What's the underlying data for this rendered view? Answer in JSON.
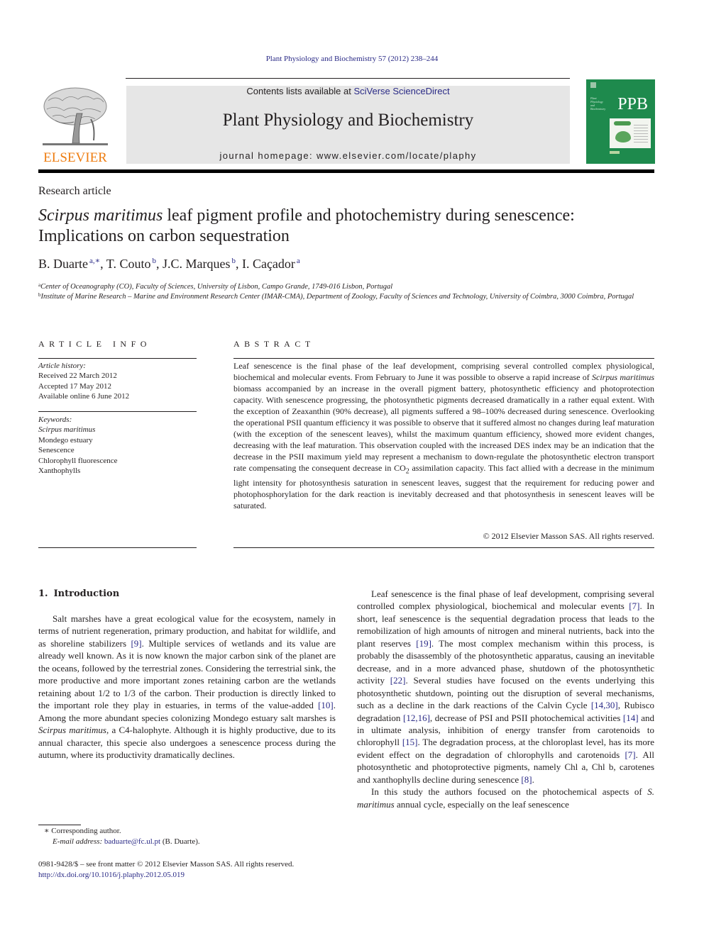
{
  "header": {
    "citation": "Plant Physiology and Biochemistry 57 (2012) 238–244",
    "contents_prefix": "Contents lists available at ",
    "contents_link": "SciVerse ScienceDirect",
    "journal_name": "Plant Physiology and Biochemistry",
    "homepage_prefix": "journal homepage: ",
    "homepage_url": "www.elsevier.com/locate/plaphy",
    "publisher_wordmark": "ELSEVIER",
    "cover_abbrev": "PPB",
    "cover_title_lines": [
      "Plant",
      "Physiology",
      "and",
      "Biochemistry"
    ],
    "colors": {
      "link": "#2a2a86",
      "elsevier_orange": "#ee7d11",
      "cover_green": "#1e8a4d",
      "masthead_gray": "#e6e6e6"
    }
  },
  "article": {
    "type": "Research article",
    "title_italic": "Scirpus maritimus",
    "title_rest_line1": " leaf pigment profile and photochemistry during senescence:",
    "title_line2": "Implications on carbon sequestration",
    "authors": [
      {
        "name": "B. Duarte",
        "sup": "a,∗",
        "sep": ", "
      },
      {
        "name": "T. Couto",
        "sup": "b",
        "sep": ", "
      },
      {
        "name": "J.C. Marques",
        "sup": "b",
        "sep": ", "
      },
      {
        "name": "I. Caçador",
        "sup": "a",
        "sep": ""
      }
    ],
    "affiliations": [
      {
        "key": "a",
        "text": "Center of Oceanography (CO), Faculty of Sciences, University of Lisbon, Campo Grande, 1749-016 Lisbon, Portugal"
      },
      {
        "key": "b",
        "text": "Institute of Marine Research – Marine and Environment Research Center (IMAR-CMA), Department of Zoology, Faculty of Sciences and Technology, University of Coimbra, 3000 Coimbra, Portugal"
      }
    ]
  },
  "article_info": {
    "heading": "ARTICLE INFO",
    "history_label": "Article history:",
    "history": [
      "Received 22 March 2012",
      "Accepted 17 May 2012",
      "Available online 6 June 2012"
    ],
    "keywords_label": "Keywords:",
    "keywords": [
      "Scirpus maritimus",
      "Mondego estuary",
      "Senescence",
      "Chlorophyll fluorescence",
      "Xanthophylls"
    ]
  },
  "abstract": {
    "heading": "ABSTRACT",
    "part1": "Leaf senescence is the final phase of the leaf development, comprising several controlled complex physiological, biochemical and molecular events. From February to June it was possible to observe a rapid increase of ",
    "italic1": "Scirpus maritimus",
    "part2": " biomass accompanied by an increase in the overall pigment battery, photosynthetic efficiency and photoprotection capacity. With senescence progressing, the photosyn­thetic pigments decreased dramatically in a rather equal extent. With the exception of Zeaxanthin (90% decrease), all pigments suffered a 98–100% decreased during senescence. Overlooking the operational PSII quantum efficiency it was possible to observe that it suffered almost no changes during leaf maturation (with the exception of the senescent leaves), whilst the maximum quantum efficiency, showed more evident changes, decreasing with the leaf maturation. This observation coupled with the increased DES index may be an indication that the decrease in the PSII maximum yield may represent a mechanism to down-regulate the photosynthetic electron transport rate compensating the consequent decrease in CO",
    "sub": "2",
    "part3": " assimilation capacity. This fact allied with a decrease in the minimum light intensity for photosynthesis saturation in senescent leaves, suggest that the requirement for reducing power and photophosphorylation for the dark reaction is inevitably decreased and that photosynthesis in senescent leaves will be saturated.",
    "copyright": "© 2012 Elsevier Masson SAS. All rights reserved."
  },
  "introduction": {
    "number": "1.",
    "title": "Introduction",
    "left_paragraph": {
      "t1": "Salt marshes have a great ecological value for the ecosystem, namely in terms of nutrient regeneration, primary production, and habitat for wildlife, and as shoreline stabilizers ",
      "r1": "[9]",
      "t2": ". Multiple services of wetlands and its value are already well known. As it is now known the major carbon sink of the planet are the oceans, followed by the terrestrial zones. Considering the terrestrial sink, the more productive and more important zones retaining carbon are the wetlands retaining about 1/2 to 1/3 of the carbon. Their production is directly linked to the important role they play in estuaries, in terms of the value-added ",
      "r2": "[10]",
      "t3": ". Among the more abundant species colonizing Mondego estuary salt marshes is ",
      "i1": "Scirpus maritimus",
      "t4": ", a C4-halophyte. Although it is highly productive, due to its annual character, this specie also undergoes a senescence process during the autumn, where its productivity dramatically declines."
    },
    "right_paragraph_1": {
      "t1": "Leaf senescence is the final phase of leaf development, comprising several controlled complex physiological, biochemical and molecular events ",
      "r1": "[7]",
      "t2": ". In short, leaf senescence is the sequential degradation process that leads to the remobilization of high amounts of nitrogen and mineral nutrients, back into the plant reserves ",
      "r2": "[19]",
      "t3": ". The most complex mechanism within this process, is probably the disassembly of the photosynthetic apparatus, causing an inevitable decrease, and in a more advanced phase, shutdown of the photosynthetic activity ",
      "r3": "[22]",
      "t4": ". Several studies have focused on the events underlying this photosynthetic shutdown, pointing out the disruption of several mechanisms, such as a decline in the dark reactions of the Calvin Cycle ",
      "r4": "[14,30]",
      "t5": ", Rubisco degradation ",
      "r5": "[12,16]",
      "t6": ", decrease of PSI and PSII photochemical activities ",
      "r6": "[14]",
      "t7": " and in ulti­mate analysis, inhibition of energy transfer from carotenoids to chlorophyll ",
      "r7": "[15]",
      "t8": ". The degradation process, at the chloroplast level, has its more evident effect on the degradation of chlorophylls and carotenoids ",
      "r8": "[7]",
      "t9": ". All photosynthetic and photoprotective pigments, namely Chl a, Chl b, carotenes and xanthophylls decline during senescence ",
      "r9": "[8]",
      "t10": "."
    },
    "right_paragraph_2": {
      "t1": "In this study the authors focused on the photochemical aspects of ",
      "i1": "S. maritimus",
      "t2": " annual cycle, especially on the leaf senescence"
    }
  },
  "footnotes": {
    "star": "∗",
    "corresponding": "Corresponding author.",
    "email_label": "E-mail address:",
    "email": "baduarte@fc.ul.pt",
    "email_owner": " (B. Duarte).",
    "issn_line": "0981-9428/$ – see front matter © 2012 Elsevier Masson SAS. All rights reserved.",
    "doi": "http://dx.doi.org/10.1016/j.plaphy.2012.05.019"
  }
}
